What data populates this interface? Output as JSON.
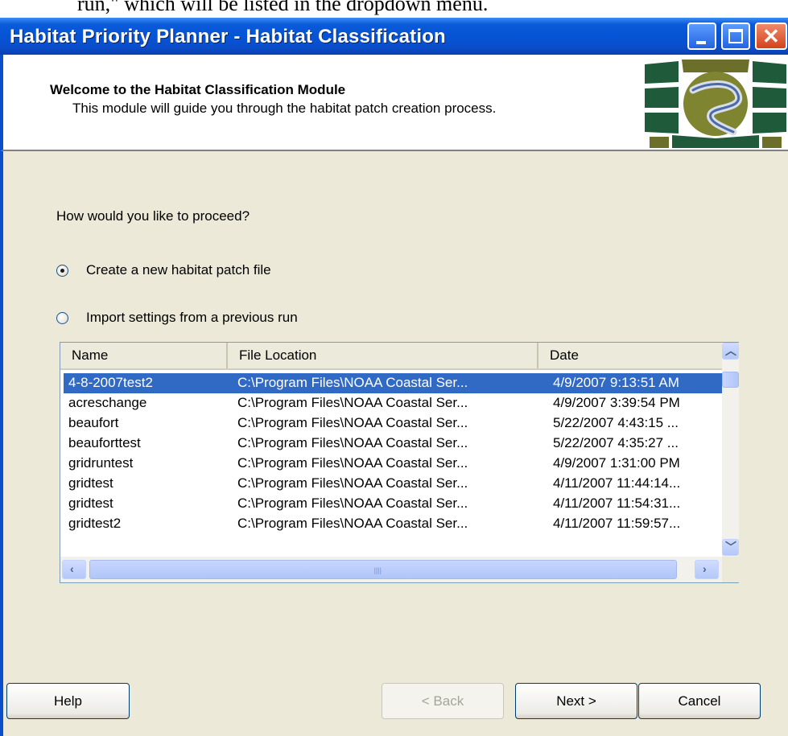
{
  "doc_fragment": "run,\" which will be listed in the dropdown menu.",
  "window": {
    "title": "Habitat Priority Planner - Habitat Classification"
  },
  "header": {
    "title": "Welcome to the Habitat Classification Module",
    "subtitle": "This module will guide you through the habitat patch creation process."
  },
  "main": {
    "prompt": "How would you like to proceed?",
    "options": [
      {
        "label": "Create a new habitat patch file",
        "selected": true
      },
      {
        "label": "Import settings from a previous run",
        "selected": false
      }
    ]
  },
  "list": {
    "columns": [
      "Name",
      "File Location",
      "Date"
    ],
    "rows": [
      {
        "name": "4-8-2007test2",
        "location": "C:\\Program Files\\NOAA Coastal Ser...",
        "date": "4/9/2007 9:13:51 AM",
        "selected": true
      },
      {
        "name": "acreschange",
        "location": "C:\\Program Files\\NOAA Coastal Ser...",
        "date": "4/9/2007 3:39:54 PM"
      },
      {
        "name": "beaufort",
        "location": "C:\\Program Files\\NOAA Coastal Ser...",
        "date": "5/22/2007 4:43:15 ..."
      },
      {
        "name": "beauforttest",
        "location": "C:\\Program Files\\NOAA Coastal Ser...",
        "date": "5/22/2007 4:35:27 ..."
      },
      {
        "name": "gridruntest",
        "location": "C:\\Program Files\\NOAA Coastal Ser...",
        "date": "4/9/2007 1:31:00 PM"
      },
      {
        "name": "gridtest",
        "location": "C:\\Program Files\\NOAA Coastal Ser...",
        "date": "4/11/2007 11:44:14..."
      },
      {
        "name": "gridtest",
        "location": "C:\\Program Files\\NOAA Coastal Ser...",
        "date": "4/11/2007 11:54:31..."
      },
      {
        "name": "gridtest2",
        "location": "C:\\Program Files\\NOAA Coastal Ser...",
        "date": "4/11/2007 11:59:57..."
      }
    ],
    "hscroll_grip": "IIII"
  },
  "footer": {
    "help_label": "Help",
    "back_label": "< Back",
    "next_label": "Next >",
    "cancel_label": "Cancel"
  },
  "colors": {
    "titlebar": "#0554d6",
    "selection": "#316ac5",
    "dialog_bg": "#ece9d8",
    "logo_green": "#1f5a3a",
    "logo_olive": "#6b6f2a"
  }
}
